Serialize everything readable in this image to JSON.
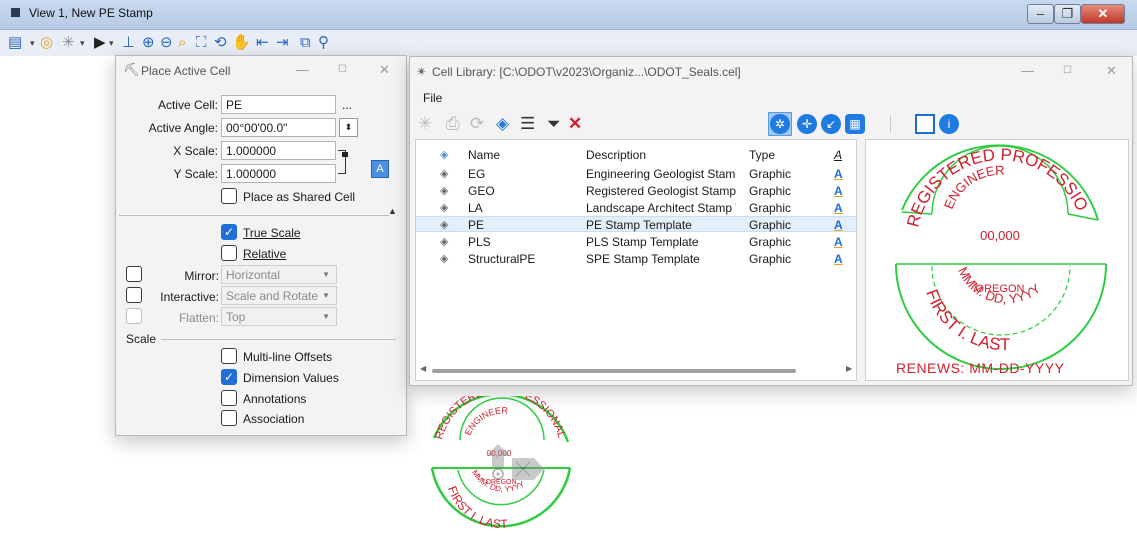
{
  "view_window": {
    "title": "View 1, New PE Stamp",
    "min": "–",
    "max": "❐",
    "close": "✕"
  },
  "view_toolbar": {
    "icons": [
      "view-attributes-icon",
      "display-style-icon",
      "levels-icon",
      "select-icon",
      "update-icon",
      "zoom-in-icon",
      "zoom-out-icon",
      "window-area-icon",
      "fit-view-icon",
      "rotate-view-icon",
      "pan-icon",
      "previous-view-icon",
      "next-view-icon",
      "copy-view-icon",
      "camera-icon"
    ]
  },
  "place_active_cell": {
    "title": "Place Active Cell",
    "active_cell_label": "Active Cell:",
    "active_cell_value": "PE",
    "browse": "...",
    "active_angle_label": "Active Angle:",
    "active_angle_value": "00°00'00.0\"",
    "x_scale_label": "X Scale:",
    "x_scale_value": "1.000000",
    "y_scale_label": "Y Scale:",
    "y_scale_value": "1.000000",
    "place_shared_label": "Place as Shared Cell",
    "true_scale_label": "True Scale",
    "true_scale_checked": true,
    "relative_label": "Relative",
    "mirror_label": "Mirror:",
    "mirror_value": "Horizontal",
    "interactive_label": "Interactive:",
    "interactive_value": "Scale and Rotate",
    "flatten_label": "Flatten:",
    "flatten_value": "Top",
    "scale_section": "Scale",
    "multiline_label": "Multi-line Offsets",
    "dimension_label": "Dimension Values",
    "dimension_checked": true,
    "annotations_label": "Annotations",
    "association_label": "Association"
  },
  "cell_library": {
    "title": "Cell Library: [C:\\ODOT\\v2023\\Organiz...\\ODOT_Seals.cel]",
    "menu_file": "File",
    "columns": [
      "Name",
      "Description",
      "Type"
    ],
    "rows": [
      {
        "name": "EG",
        "description": "Engineering Geologist Stamp ...",
        "type": "Graphic"
      },
      {
        "name": "GEO",
        "description": "Registered Geologist Stamp T...",
        "type": "Graphic"
      },
      {
        "name": "LA",
        "description": "Landscape Architect Stamp T...",
        "type": "Graphic"
      },
      {
        "name": "PE",
        "description": "PE Stamp Template",
        "type": "Graphic",
        "selected": true
      },
      {
        "name": "PLS",
        "description": "PLS Stamp Template",
        "type": "Graphic"
      },
      {
        "name": "StructuralPE",
        "description": "SPE Stamp Template",
        "type": "Graphic"
      }
    ],
    "font_col_glyph": "A",
    "preview": {
      "arc_top": "REGISTERED PROFESSIONAL",
      "engineer": "ENGINEER",
      "number": "00,000",
      "oregon": "OREGON",
      "date": "MMM. DD, YYYY",
      "name": "FIRST I. LAST",
      "renews": "RENEWS: MM-DD-YYYY"
    }
  },
  "colors": {
    "stamp_red": "#d1202f",
    "stamp_green": "#2ecc40",
    "accent_blue": "#1f6fd6"
  }
}
